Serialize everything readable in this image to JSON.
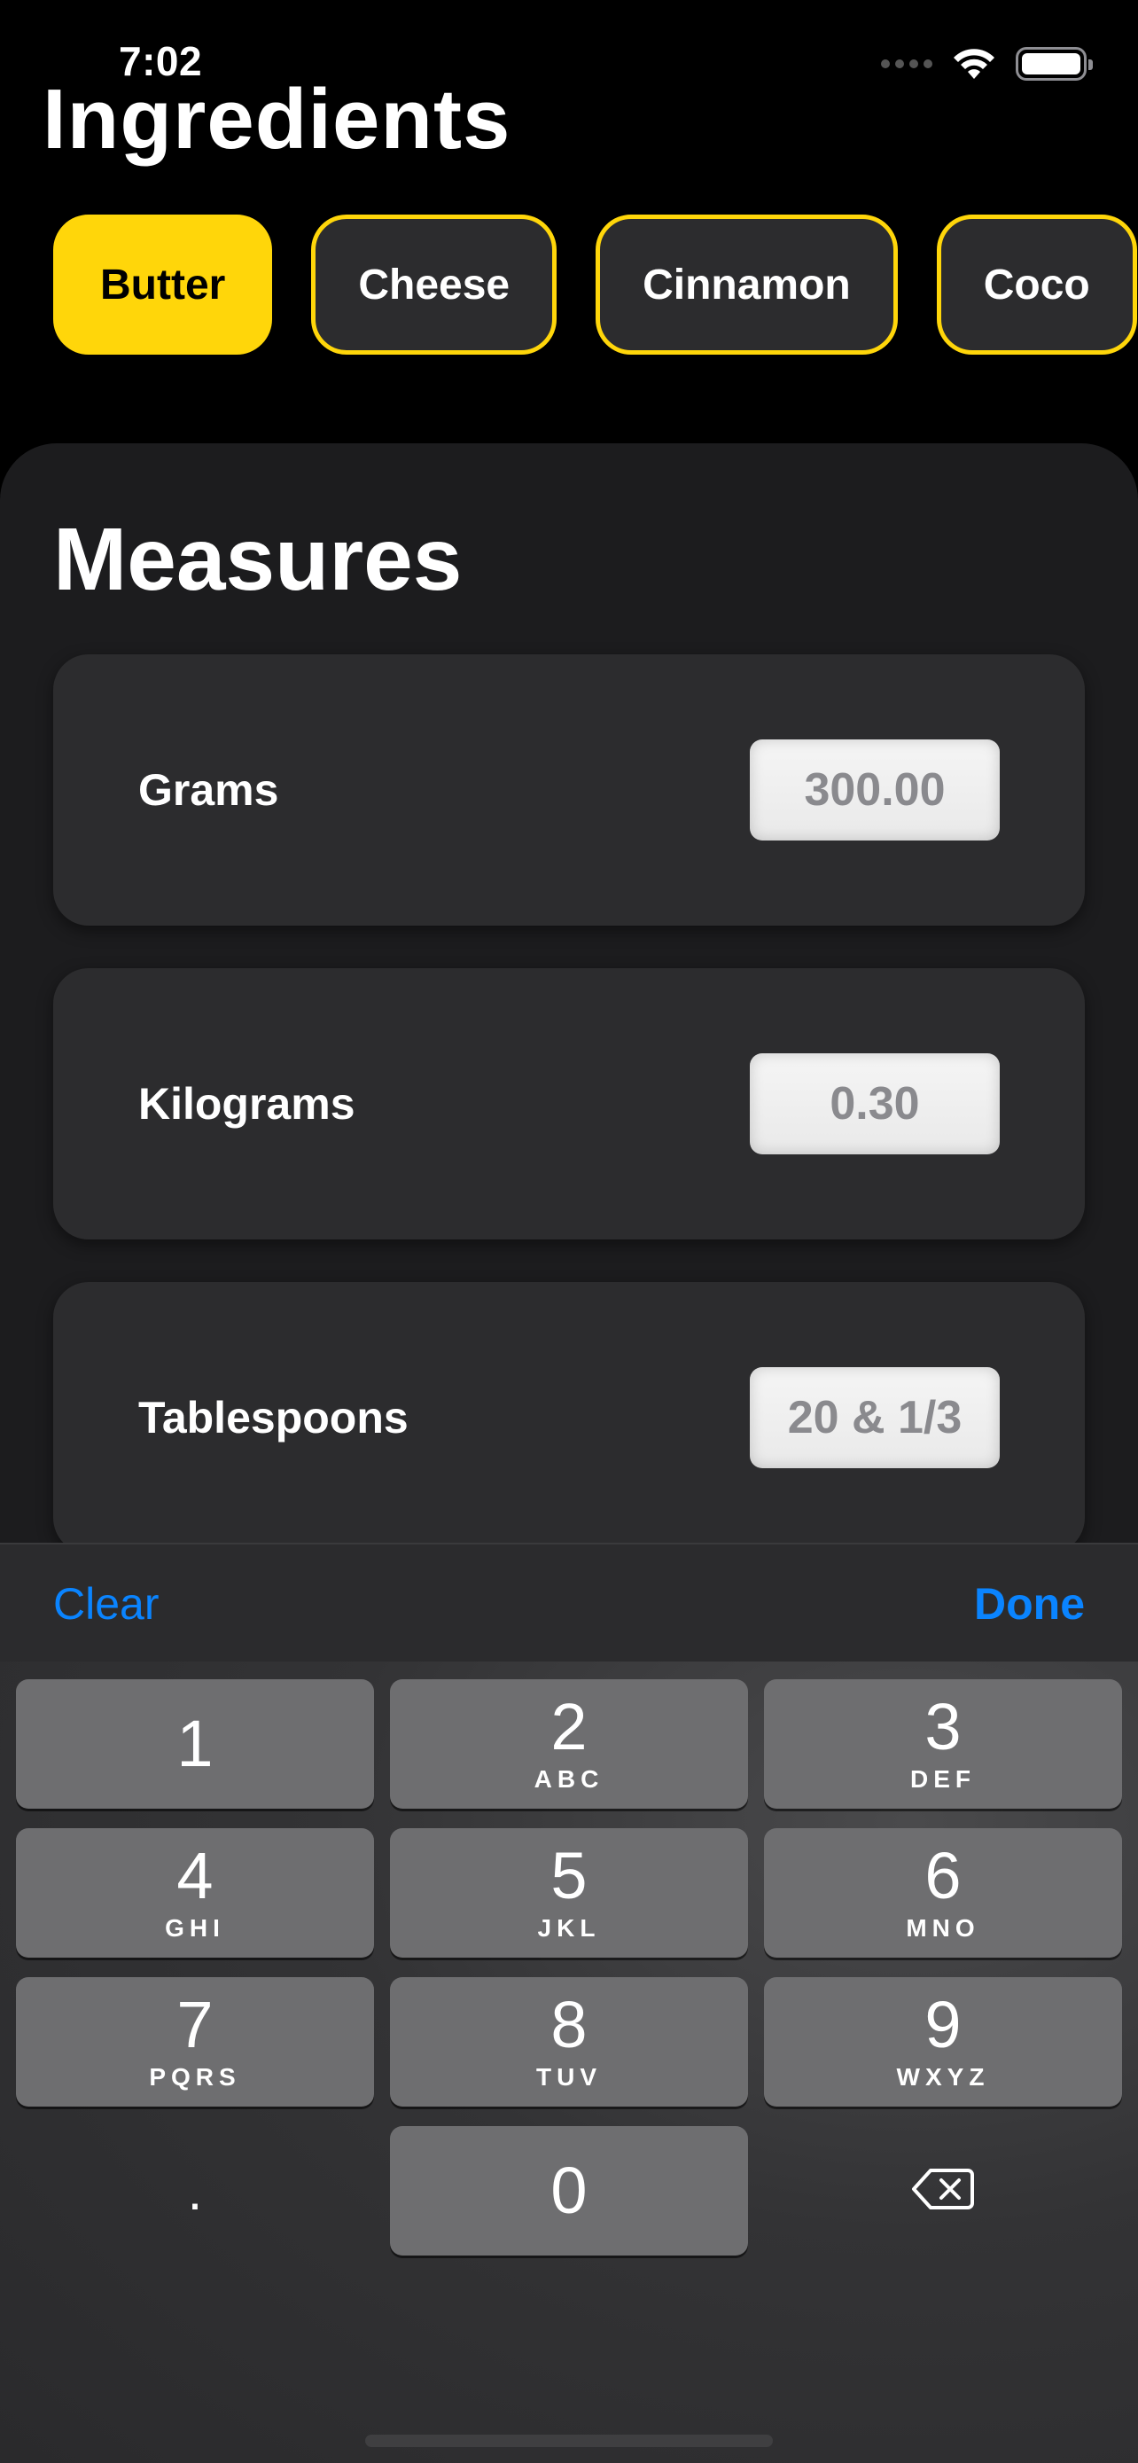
{
  "status_bar": {
    "time": "7:02"
  },
  "title": "Ingredients",
  "chips": [
    {
      "label": "Butter",
      "selected": true
    },
    {
      "label": "Cheese",
      "selected": false
    },
    {
      "label": "Cinnamon",
      "selected": false
    },
    {
      "label": "Coco",
      "selected": false
    }
  ],
  "measures": {
    "title": "Measures",
    "rows": [
      {
        "label": "Grams",
        "value": "300.00"
      },
      {
        "label": "Kilograms",
        "value": "0.30"
      },
      {
        "label": "Tablespoons",
        "value": "20 & 1/3"
      }
    ]
  },
  "keyboard_toolbar": {
    "clear_label": "Clear",
    "done_label": "Done"
  },
  "keypad": {
    "keys": [
      {
        "digit": "1",
        "letters": ""
      },
      {
        "digit": "2",
        "letters": "ABC"
      },
      {
        "digit": "3",
        "letters": "DEF"
      },
      {
        "digit": "4",
        "letters": "GHI"
      },
      {
        "digit": "5",
        "letters": "JKL"
      },
      {
        "digit": "6",
        "letters": "MNO"
      },
      {
        "digit": "7",
        "letters": "PQRS"
      },
      {
        "digit": "8",
        "letters": "TUV"
      },
      {
        "digit": "9",
        "letters": "WXYZ"
      },
      {
        "digit": "0",
        "letters": ""
      }
    ],
    "decimal_label": ".",
    "delete_icon": "backspace-icon"
  },
  "colors": {
    "accent_yellow": "#ffd60a",
    "link_blue": "#0a84ff",
    "card_bg": "#2c2c2e",
    "panel_bg": "#1c1c1e"
  }
}
